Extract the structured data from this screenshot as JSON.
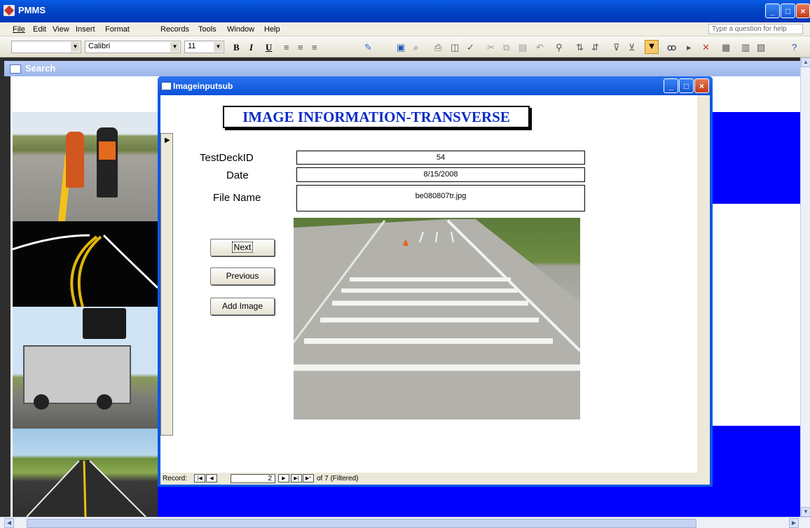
{
  "app": {
    "title": "PMMS"
  },
  "menu": [
    "File",
    "Edit",
    "View",
    "Insert",
    "Format",
    "Records",
    "Tools",
    "Window",
    "Help"
  ],
  "help_box": {
    "placeholder": "Type a question for help"
  },
  "toolbar": {
    "object_combo": "",
    "font_name": "Calibri",
    "font_size": "11",
    "bold": "B",
    "italic": "I",
    "underline": "U"
  },
  "search_window": {
    "title": "Search"
  },
  "subform": {
    "title": "Imageinputsub",
    "heading": "IMAGE INFORMATION-TRANSVERSE",
    "fields": {
      "testdeck_label": "TestDeckID",
      "testdeck_value": "54",
      "date_label": "Date",
      "date_value": "8/15/2008",
      "filename_label": "File Name",
      "filename_value": "be080807tr.jpg"
    },
    "buttons": {
      "next": "Next",
      "previous": "Previous",
      "add_image": "Add Image"
    },
    "record_nav": {
      "label": "Record:",
      "current": "2",
      "of_text": "of 7 (Filtered)"
    }
  },
  "colors": {
    "blue_panel": "#0000ff",
    "title_blue": "#0a2bc4"
  }
}
